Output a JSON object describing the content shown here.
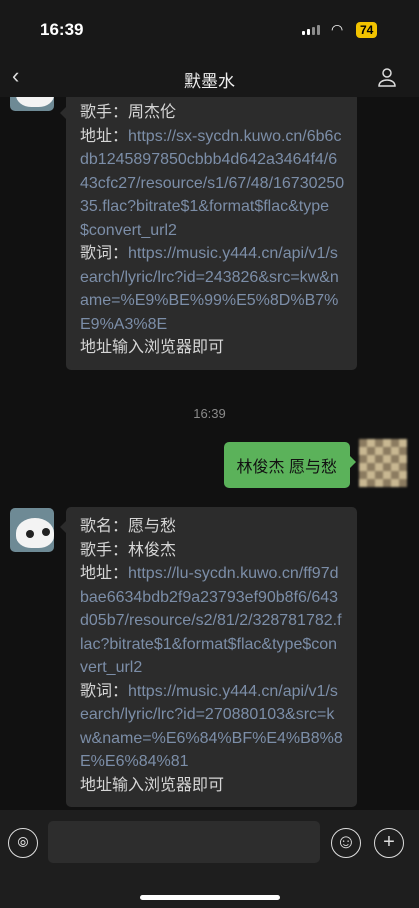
{
  "status": {
    "time": "16:39",
    "battery": "74"
  },
  "nav": {
    "back": "‹",
    "title": "默墨水"
  },
  "messages": [
    {
      "from": "other",
      "lines": [
        {
          "label": "歌手：",
          "text": "周杰伦"
        },
        {
          "label": "地址：",
          "link": "https://sx-sycdn.kuwo.cn/6b6cdb1245897850cbbb4d642a3464f4/643cfc27/resource/s1/67/48/1673025035.flac?bitrate$1&format$flac&type$convert_url2"
        },
        {
          "label": "歌词：",
          "link": "https://music.y444.cn/api/v1/search/lyric/lrc?id=243826&src=kw&name=%E9%BE%99%E5%8D%B7%E9%A3%8E"
        },
        {
          "text": "地址输入浏览器即可"
        }
      ]
    },
    {
      "timestamp": "16:39"
    },
    {
      "from": "me",
      "text": "林俊杰 愿与愁"
    },
    {
      "from": "other",
      "lines": [
        {
          "label": "歌名：",
          "text": "愿与愁"
        },
        {
          "label": "歌手：",
          "text": "林俊杰"
        },
        {
          "label": "地址：",
          "link": "https://lu-sycdn.kuwo.cn/ff97dbae6634bdb2f9a23793ef90b8f6/643d05b7/resource/s2/81/2/328781782.flac?bitrate$1&format$flac&type$convert_url2"
        },
        {
          "label": "歌词：",
          "link": "https://music.y444.cn/api/v1/search/lyric/lrc?id=270880103&src=kw&name=%E6%84%BF%E4%B8%8E%E6%84%81"
        },
        {
          "text": "地址输入浏览器即可"
        }
      ]
    }
  ]
}
